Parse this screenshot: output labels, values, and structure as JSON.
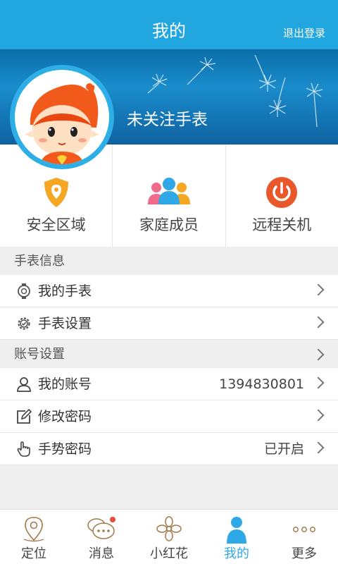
{
  "header": {
    "title": "我的",
    "logout_label": "退出登录"
  },
  "banner": {
    "watch_status": "未关注手表"
  },
  "actions": [
    {
      "label": "安全区域",
      "icon": "shield-icon",
      "color": "#f5a623"
    },
    {
      "label": "家庭成员",
      "icon": "family-icon",
      "color": "#2ea8e6"
    },
    {
      "label": "远程关机",
      "icon": "power-icon",
      "color": "#e8582a"
    }
  ],
  "watch_section": {
    "title": "手表信息",
    "items": [
      {
        "label": "我的手表",
        "icon": "watch-icon"
      },
      {
        "label": "手表设置",
        "icon": "gear-icon"
      }
    ]
  },
  "account_section": {
    "title": "账号设置",
    "items": [
      {
        "label": "我的账号",
        "value": "1394830801",
        "icon": "user-icon"
      },
      {
        "label": "修改密码",
        "value": "",
        "icon": "edit-icon"
      },
      {
        "label": "手势密码",
        "value": "已开启",
        "icon": "hand-pointer-icon"
      }
    ]
  },
  "bottom_nav": [
    {
      "label": "定位",
      "icon": "location-icon"
    },
    {
      "label": "消息",
      "icon": "message-icon"
    },
    {
      "label": "小红花",
      "icon": "flower-icon"
    },
    {
      "label": "我的",
      "icon": "person-icon",
      "active": true
    },
    {
      "label": "更多",
      "icon": "more-icon"
    }
  ],
  "colors": {
    "header": "#22a6df",
    "accent": "#2ea8e6",
    "background": "#efefef"
  }
}
